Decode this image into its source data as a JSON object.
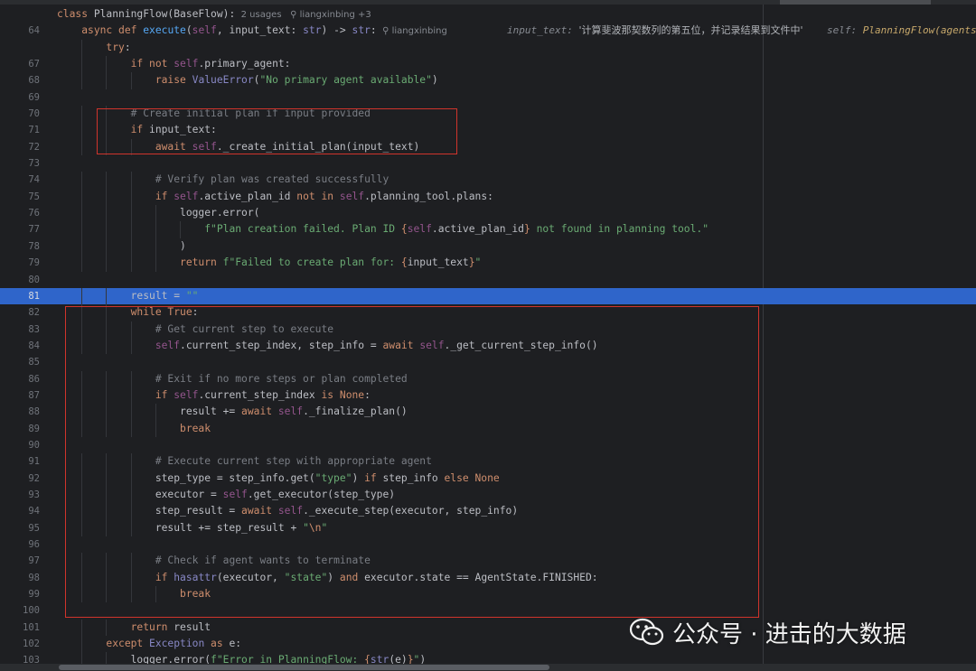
{
  "editor": {
    "lines": [
      {
        "n": "",
        "segs": [
          [
            "kw",
            "class "
          ],
          [
            "p",
            "PlanningFlow(BaseFlow):"
          ]
        ],
        "hints": [
          [
            "hint",
            "  2 usages"
          ],
          [
            "hint",
            "   ⚲ liangxinbing +3"
          ]
        ]
      },
      {
        "n": "64",
        "segs": [
          [
            "p",
            "    "
          ],
          [
            "kw",
            "async def "
          ],
          [
            "fn",
            "execute"
          ],
          [
            "p",
            "("
          ],
          [
            "self",
            "self"
          ],
          [
            "p",
            ", input_text: "
          ],
          [
            "builtin",
            "str"
          ],
          [
            "p",
            ") -> "
          ],
          [
            "builtin",
            "str"
          ],
          [
            "p",
            ":"
          ]
        ],
        "hints": [
          [
            "hint",
            "  ⚲ liangxinbing"
          ],
          [
            "hint-it",
            "          input_text: "
          ],
          [
            "inlay",
            "'计算斐波那契数列的第五位，并记录结果到文件中'"
          ],
          [
            "hint-it",
            "    self: "
          ],
          [
            "inlay-val",
            "PlanningFlow(agents={'m"
          ]
        ]
      },
      {
        "n": "",
        "segs": [
          [
            "p",
            "        "
          ],
          [
            "kw",
            "try"
          ],
          [
            "p",
            ":"
          ]
        ]
      },
      {
        "n": "67",
        "segs": [
          [
            "p",
            "            "
          ],
          [
            "kw",
            "if not "
          ],
          [
            "self",
            "self"
          ],
          [
            "p",
            ".primary_agent:"
          ]
        ]
      },
      {
        "n": "68",
        "segs": [
          [
            "p",
            "                "
          ],
          [
            "kw",
            "raise "
          ],
          [
            "builtin",
            "ValueError"
          ],
          [
            "p",
            "("
          ],
          [
            "str",
            "\"No primary agent available\""
          ],
          [
            "p",
            ")"
          ]
        ]
      },
      {
        "n": "69",
        "segs": []
      },
      {
        "n": "70",
        "segs": [
          [
            "p",
            "            "
          ],
          [
            "cm",
            "# Create initial plan if input provided"
          ]
        ]
      },
      {
        "n": "71",
        "segs": [
          [
            "p",
            "            "
          ],
          [
            "kw",
            "if "
          ],
          [
            "p",
            "input_text:"
          ]
        ]
      },
      {
        "n": "72",
        "segs": [
          [
            "p",
            "                "
          ],
          [
            "kw",
            "await "
          ],
          [
            "self",
            "self"
          ],
          [
            "p",
            "._create_initial_plan(input_text)"
          ]
        ]
      },
      {
        "n": "73",
        "segs": []
      },
      {
        "n": "74",
        "segs": [
          [
            "p",
            "                "
          ],
          [
            "cm",
            "# Verify plan was created successfully"
          ]
        ]
      },
      {
        "n": "75",
        "segs": [
          [
            "p",
            "                "
          ],
          [
            "kw",
            "if "
          ],
          [
            "self",
            "self"
          ],
          [
            "p",
            ".active_plan_id "
          ],
          [
            "kw",
            "not in "
          ],
          [
            "self",
            "self"
          ],
          [
            "p",
            ".planning_tool.plans:"
          ]
        ]
      },
      {
        "n": "76",
        "segs": [
          [
            "p",
            "                    logger.error("
          ]
        ]
      },
      {
        "n": "77",
        "segs": [
          [
            "p",
            "                        "
          ],
          [
            "str",
            "f\"Plan creation failed. Plan ID "
          ],
          [
            "kw",
            "{"
          ],
          [
            "self",
            "self"
          ],
          [
            "p",
            ".active_plan_id"
          ],
          [
            "kw",
            "}"
          ],
          [
            "str",
            " not found in planning tool.\""
          ]
        ]
      },
      {
        "n": "78",
        "segs": [
          [
            "p",
            "                    )"
          ]
        ]
      },
      {
        "n": "79",
        "segs": [
          [
            "p",
            "                    "
          ],
          [
            "kw",
            "return "
          ],
          [
            "str",
            "f\"Failed to create plan for: "
          ],
          [
            "kw",
            "{"
          ],
          [
            "p",
            "input_text"
          ],
          [
            "kw",
            "}"
          ],
          [
            "str",
            "\""
          ]
        ]
      },
      {
        "n": "80",
        "segs": []
      },
      {
        "n": "81",
        "segs": [
          [
            "p",
            "            result = "
          ],
          [
            "str",
            "\"\""
          ]
        ],
        "current": true
      },
      {
        "n": "82",
        "segs": [
          [
            "p",
            "            "
          ],
          [
            "kw",
            "while True"
          ],
          [
            "p",
            ":"
          ]
        ]
      },
      {
        "n": "83",
        "segs": [
          [
            "p",
            "                "
          ],
          [
            "cm",
            "# Get current step to execute"
          ]
        ]
      },
      {
        "n": "84",
        "segs": [
          [
            "p",
            "                "
          ],
          [
            "self",
            "self"
          ],
          [
            "p",
            ".current_step_index, step_info = "
          ],
          [
            "kw",
            "await "
          ],
          [
            "self",
            "self"
          ],
          [
            "p",
            "._get_current_step_info()"
          ]
        ]
      },
      {
        "n": "85",
        "segs": []
      },
      {
        "n": "86",
        "segs": [
          [
            "p",
            "                "
          ],
          [
            "cm",
            "# Exit if no more steps or plan completed"
          ]
        ]
      },
      {
        "n": "87",
        "segs": [
          [
            "p",
            "                "
          ],
          [
            "kw",
            "if "
          ],
          [
            "self",
            "self"
          ],
          [
            "p",
            ".current_step_index "
          ],
          [
            "kw",
            "is None"
          ],
          [
            "p",
            ":"
          ]
        ]
      },
      {
        "n": "88",
        "segs": [
          [
            "p",
            "                    result += "
          ],
          [
            "kw",
            "await "
          ],
          [
            "self",
            "self"
          ],
          [
            "p",
            "._finalize_plan()"
          ]
        ]
      },
      {
        "n": "89",
        "segs": [
          [
            "p",
            "                    "
          ],
          [
            "kw",
            "break"
          ]
        ]
      },
      {
        "n": "90",
        "segs": []
      },
      {
        "n": "91",
        "segs": [
          [
            "p",
            "                "
          ],
          [
            "cm",
            "# Execute current step with appropriate agent"
          ]
        ]
      },
      {
        "n": "92",
        "segs": [
          [
            "p",
            "                step_type = step_info.get("
          ],
          [
            "str",
            "\"type\""
          ],
          [
            "p",
            ") "
          ],
          [
            "kw",
            "if "
          ],
          [
            "p",
            "step_info "
          ],
          [
            "kw",
            "else None"
          ]
        ]
      },
      {
        "n": "93",
        "segs": [
          [
            "p",
            "                executor = "
          ],
          [
            "self",
            "self"
          ],
          [
            "p",
            ".get_executor(step_type)"
          ]
        ]
      },
      {
        "n": "94",
        "segs": [
          [
            "p",
            "                step_result = "
          ],
          [
            "kw",
            "await "
          ],
          [
            "self",
            "self"
          ],
          [
            "p",
            "._execute_step(executor, step_info)"
          ]
        ]
      },
      {
        "n": "95",
        "segs": [
          [
            "p",
            "                result += step_result + "
          ],
          [
            "str",
            "\""
          ],
          [
            "kw",
            "\\n"
          ],
          [
            "str",
            "\""
          ]
        ]
      },
      {
        "n": "96",
        "segs": []
      },
      {
        "n": "97",
        "segs": [
          [
            "p",
            "                "
          ],
          [
            "cm",
            "# Check if agent wants to terminate"
          ]
        ]
      },
      {
        "n": "98",
        "segs": [
          [
            "p",
            "                "
          ],
          [
            "kw",
            "if "
          ],
          [
            "builtin",
            "hasattr"
          ],
          [
            "p",
            "(executor, "
          ],
          [
            "str",
            "\"state\""
          ],
          [
            "p",
            ") "
          ],
          [
            "kw",
            "and "
          ],
          [
            "p",
            "executor.state == AgentState.FINISHED:"
          ]
        ]
      },
      {
        "n": "99",
        "segs": [
          [
            "p",
            "                    "
          ],
          [
            "kw",
            "break"
          ]
        ]
      },
      {
        "n": "100",
        "segs": []
      },
      {
        "n": "101",
        "segs": [
          [
            "p",
            "            "
          ],
          [
            "kw",
            "return "
          ],
          [
            "p",
            "result"
          ]
        ]
      },
      {
        "n": "102",
        "segs": [
          [
            "p",
            "        "
          ],
          [
            "kw",
            "except "
          ],
          [
            "builtin",
            "Exception "
          ],
          [
            "kw",
            "as "
          ],
          [
            "p",
            "e:"
          ]
        ]
      },
      {
        "n": "103",
        "segs": [
          [
            "p",
            "            logger.error("
          ],
          [
            "str",
            "f\"Error in PlanningFlow: "
          ],
          [
            "kw",
            "{"
          ],
          [
            "builtin",
            "str"
          ],
          [
            "p",
            "(e)"
          ],
          [
            "kw",
            "}"
          ],
          [
            "str",
            "\""
          ],
          [
            "p",
            ")"
          ]
        ]
      }
    ]
  },
  "watermark": {
    "text": "公众号 · 进击的大数据",
    "icon": "wechat-icon"
  },
  "colors": {
    "background": "#1e1f22",
    "current_line": "#2f65ca",
    "highlight_box": "#d0342c",
    "keyword": "#cf8e6d",
    "function": "#56a8f5",
    "self": "#94558d",
    "string": "#6aab73",
    "comment": "#7a7e85"
  }
}
